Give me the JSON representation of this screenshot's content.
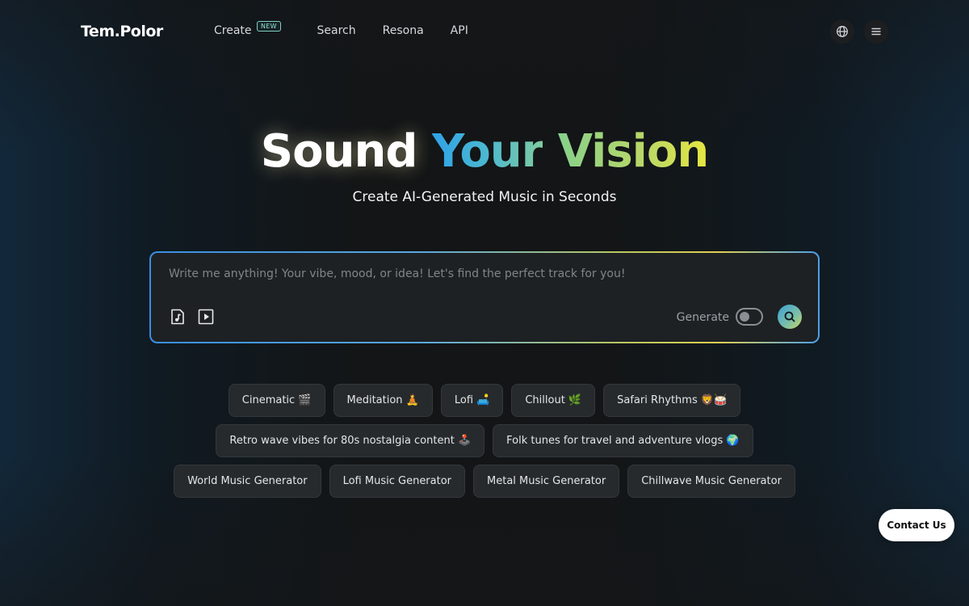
{
  "header": {
    "logo": "Tem.Polor",
    "nav": [
      {
        "label": "Create",
        "badge": "NEW"
      },
      {
        "label": "Search"
      },
      {
        "label": "Resona"
      },
      {
        "label": "API"
      }
    ],
    "icons": [
      "globe-icon",
      "menu-icon"
    ]
  },
  "hero": {
    "title_part1": "Sound",
    "title_part2": "Your",
    "title_part3": "Vision",
    "subtitle": "Create AI-Generated Music in Seconds"
  },
  "prompt": {
    "placeholder": "Write me anything! Your vibe, mood, or idea! Let's find the perfect track for you!",
    "value": "",
    "generate_label": "Generate",
    "generate_on": false
  },
  "chips": {
    "row1": [
      "Cinematic 🎬",
      "Meditation 🧘",
      "Lofi 🛋️",
      "Chillout 🌿",
      "Safari Rhythms 🦁🥁"
    ],
    "row2": [
      "Retro wave vibes for 80s nostalgia content 🕹️",
      "Folk tunes for travel and adventure vlogs 🌍"
    ],
    "row3": [
      "World Music Generator",
      "Lofi Music Generator",
      "Metal Music Generator",
      "Chillwave Music Generator"
    ]
  },
  "contact_label": "Contact Us",
  "colors": {
    "accent_blue": "#2fa2e8",
    "accent_yellow": "#e6e640",
    "chip_bg": "#262a2d"
  }
}
